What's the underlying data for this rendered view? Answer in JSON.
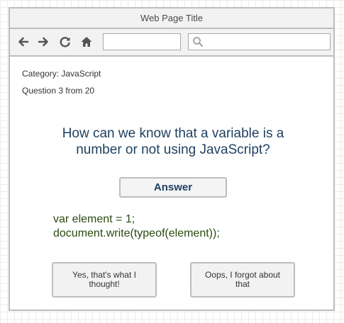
{
  "window": {
    "title": "Web Page Title"
  },
  "toolbar": {
    "back_icon": "arrow-left-icon",
    "forward_icon": "arrow-right-icon",
    "reload_icon": "reload-icon",
    "home_icon": "home-icon",
    "url_value": "",
    "search_value": "",
    "search_icon": "search-icon"
  },
  "quiz": {
    "category": "Category: JavaScript",
    "progress": "Question 3 from 20",
    "question": "How can we know that a variable is a number or not using JavaScript?",
    "answer_label": "Answer",
    "code_lines": [
      "var element = 1;",
      "document.write(typeof(element));"
    ],
    "choice_yes": "Yes, that's what I thought!",
    "choice_no": "Oops, I forgot about that"
  },
  "colors": {
    "frame_border": "#bdbdbd",
    "chrome_background": "#f2f2f2",
    "question_text": "#1f3f5f",
    "code_text": "#2c4a12"
  }
}
